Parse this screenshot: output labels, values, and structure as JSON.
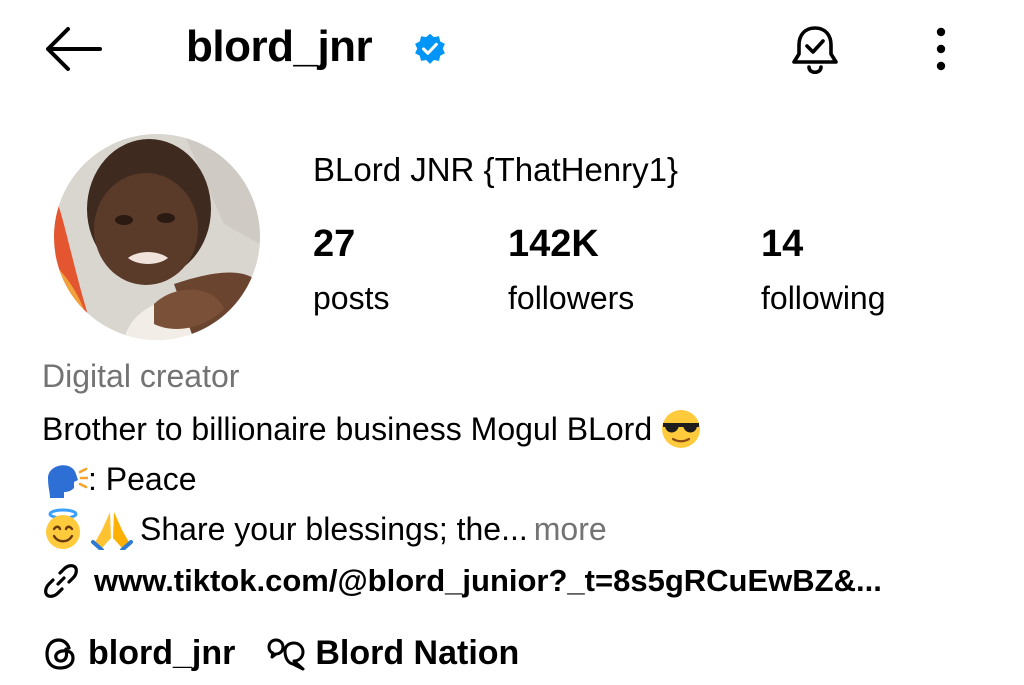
{
  "header": {
    "username": "blord_jnr",
    "icons": {
      "back": "arrow-left-icon",
      "verified": "verified-badge-icon",
      "notifications": "bell-check-icon",
      "options": "more-vertical-icon"
    }
  },
  "profile": {
    "full_name": "BLord JNR {ThatHenry1}",
    "stats": [
      {
        "value": "27",
        "label": "posts"
      },
      {
        "value": "142K",
        "label": "followers"
      },
      {
        "value": "14",
        "label": "following"
      }
    ]
  },
  "bio": {
    "category": "Digital creator",
    "line1": "Brother to billionaire business Mogul BLord",
    "line2": ": Peace",
    "line3": "Share your blessings; the...",
    "more": "more",
    "emojis": [
      "sunglasses-emoji",
      "speaking-head-emoji",
      "halo-emoji",
      "folded-hands-emoji"
    ]
  },
  "link": {
    "text": "www.tiktok.com/@blord_junior?_t=8s5gRCuEwBZ&...",
    "icon": "link-icon"
  },
  "footer": {
    "threads_handle": "blord_jnr",
    "channel": "Blord Nation",
    "icons": [
      "threads-icon",
      "broadcast-channel-icon"
    ]
  },
  "colors": {
    "verified_blue": "#0095f6",
    "secondary_text": "#737373",
    "primary_text": "#000000"
  }
}
